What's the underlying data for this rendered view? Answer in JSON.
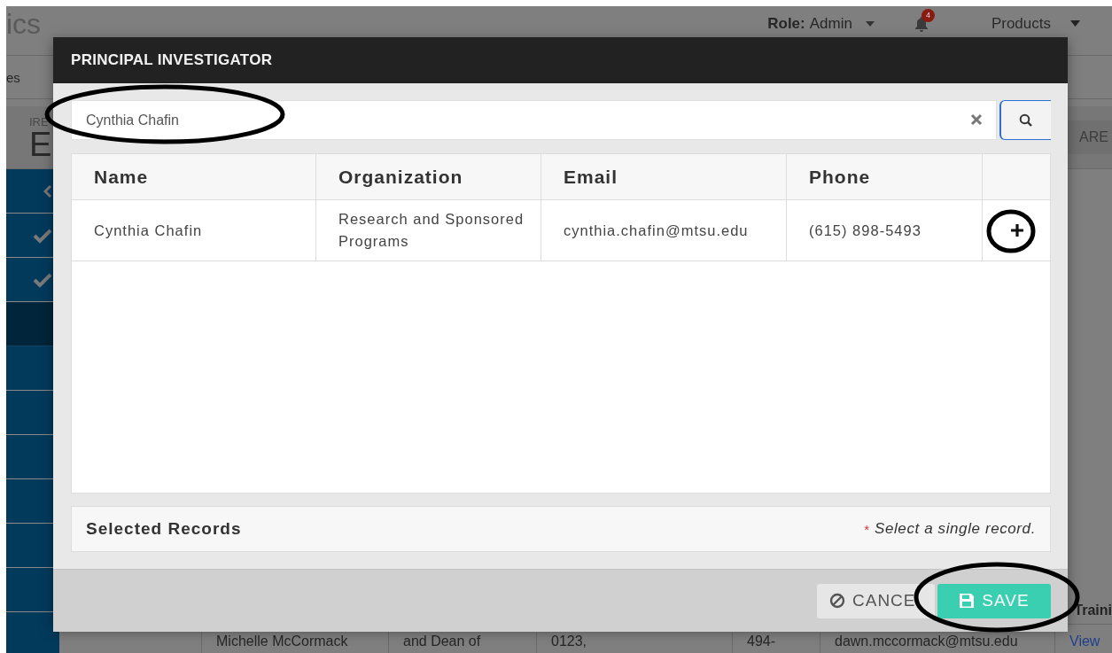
{
  "background": {
    "logo": "ics",
    "nav_tab": "es",
    "breadcrumb": "IRE",
    "page_title": "E",
    "role_menu": {
      "label": "Role:",
      "value": "Admin"
    },
    "notifications": {
      "count": "4"
    },
    "products_menu": "Products",
    "header_button": "ARE",
    "sidebar": {
      "items": [
        {
          "kind": "back",
          "selected": false
        },
        {
          "kind": "check",
          "selected": false
        },
        {
          "kind": "check",
          "selected": false
        },
        {
          "kind": "blank",
          "selected": true
        },
        {
          "kind": "blank",
          "selected": false
        },
        {
          "kind": "blank",
          "selected": false
        },
        {
          "kind": "blank",
          "selected": false
        },
        {
          "kind": "blank",
          "selected": false
        },
        {
          "kind": "blank",
          "selected": false
        },
        {
          "kind": "blank",
          "selected": false
        }
      ]
    },
    "table": {
      "column_header": "Traini",
      "row": [
        "Michelle McCormack",
        "and Dean of",
        "0123,",
        "494-",
        "dawn.mccormack@mtsu.edu",
        "View"
      ]
    }
  },
  "modal": {
    "title": "PRINCIPAL INVESTIGATOR",
    "search": {
      "value": "Cynthia Chafin"
    },
    "table": {
      "columns": [
        "Name",
        "Organization",
        "Email",
        "Phone"
      ],
      "rows": [
        {
          "cells": [
            "Cynthia Chafin",
            "Research and Sponsored Programs",
            "cynthia.chafin@mtsu.edu",
            "(615) 898-5493"
          ]
        }
      ]
    },
    "selected_records": {
      "title": "Selected Records",
      "required_mark": "*",
      "hint": "Select a single record."
    },
    "buttons": [
      {
        "kind": "cancel",
        "label": "CANCE"
      },
      {
        "kind": "save",
        "label": "SAVE"
      }
    ]
  },
  "annotations": [
    {
      "kind": "ellipse"
    },
    {
      "kind": "ellipse"
    },
    {
      "kind": "ellipse"
    }
  ]
}
